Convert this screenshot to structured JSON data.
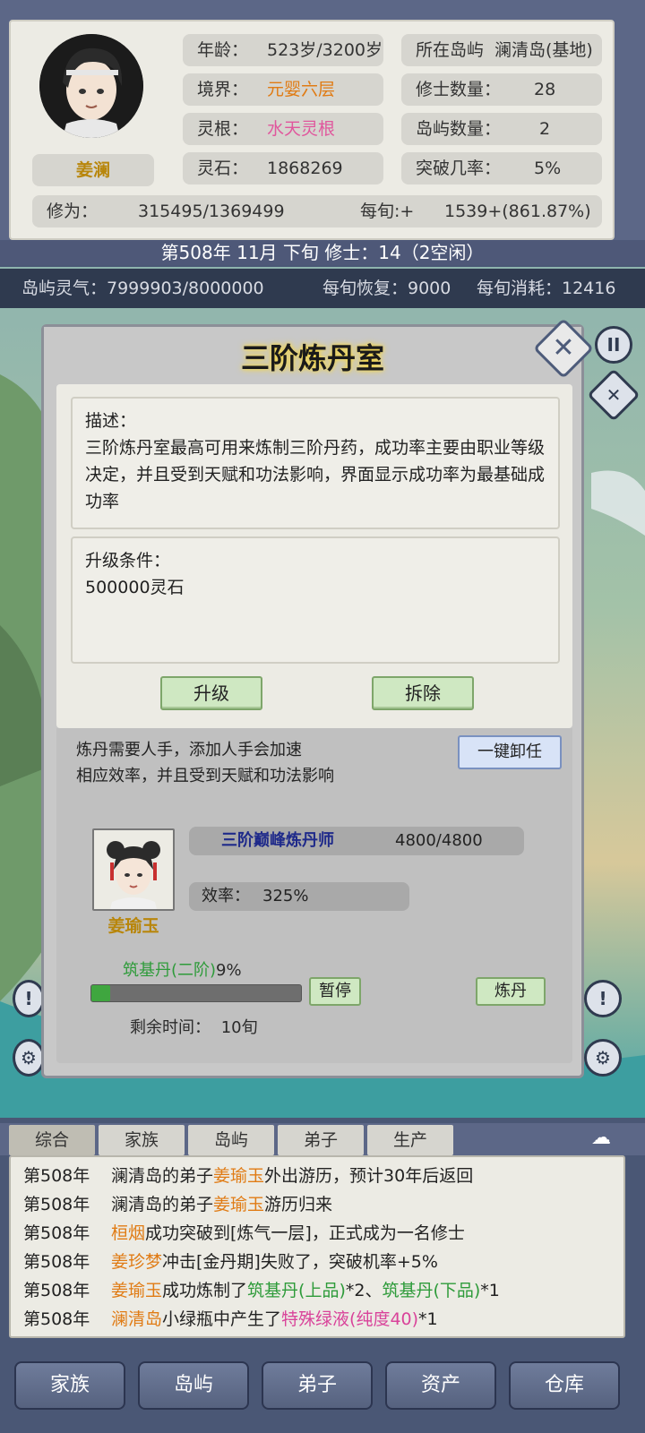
{
  "character": {
    "name": "姜澜",
    "age_label": "年龄：",
    "age_value": "523岁/3200岁",
    "realm_label": "境界：",
    "realm_value": "元婴六层",
    "root_label": "灵根：",
    "root_value": "水天灵根",
    "stone_label": "灵石：",
    "stone_value": "1868269",
    "island_label": "所在岛屿",
    "island_value": "澜清岛(基地)",
    "cultivators_label": "修士数量：",
    "cultivators_value": "28",
    "islands_label": "岛屿数量：",
    "islands_value": "2",
    "breakthrough_label": "突破几率：",
    "breakthrough_value": "5%",
    "cultivation_label": "修为：",
    "cultivation_value": "315495/1369499",
    "per_period_label": "每旬:+",
    "per_period_value": "1539+(861.87%)"
  },
  "date_bar": "第508年 11月 下旬   修士：14（2空闲）",
  "qi_bar": {
    "island_qi": "岛屿灵气：7999903/8000000",
    "recovery": "每旬恢复：9000",
    "consumption": "每旬消耗：12416"
  },
  "dialog": {
    "title": "三阶炼丹室",
    "desc_label": "描述：",
    "desc_text": "三阶炼丹室最高可用来炼制三阶丹药，成功率主要由职业等级决定，并且受到天赋和功法影响，界面显示成功率为最基础成功率",
    "upgrade_label": "升级条件：",
    "upgrade_cost": "500000灵石",
    "upgrade_button": "升级",
    "demolish_button": "拆除",
    "work_note_line1": "炼丹需要人手，添加人手会加速",
    "work_note_line2": "相应效率，并且受到天赋和功法影响",
    "unassign_button": "一键卸任",
    "worker_title": "三阶巅峰炼丹师",
    "worker_exp": "4800/4800",
    "efficiency_label": "效率：",
    "efficiency_value": "325%",
    "worker_name": "姜瑜玉",
    "craft_item": "筑基丹(二阶)",
    "craft_percent": "9%",
    "craft_progress": 0.09,
    "pause_button": "暂停",
    "craft_button": "炼丹",
    "remaining_label": "剩余时间：",
    "remaining_value": "10旬"
  },
  "log_tabs": [
    "综合",
    "家族",
    "岛屿",
    "弟子",
    "生产"
  ],
  "logs": [
    {
      "year": "第508年",
      "parts": [
        [
          "澜清岛的弟子",
          ""
        ],
        [
          "姜瑜玉",
          "orange"
        ],
        [
          "外出游历，预计30年后返回",
          ""
        ]
      ]
    },
    {
      "year": "第508年",
      "parts": [
        [
          "澜清岛的弟子",
          ""
        ],
        [
          "姜瑜玉",
          "orange"
        ],
        [
          "游历归来",
          ""
        ]
      ]
    },
    {
      "year": "第508年",
      "parts": [
        [
          "桓烟",
          "orange"
        ],
        [
          "成功突破到[炼气一层]，正式成为一名修士",
          ""
        ]
      ]
    },
    {
      "year": "第508年",
      "parts": [
        [
          "姜珍梦",
          "orange"
        ],
        [
          "冲击[金丹期]失败了，突破机率+5%",
          ""
        ]
      ]
    },
    {
      "year": "第508年",
      "parts": [
        [
          "姜瑜玉",
          "orange"
        ],
        [
          "成功炼制了",
          ""
        ],
        [
          "筑基丹(上品)",
          "green"
        ],
        [
          "*2、",
          ""
        ],
        [
          "筑基丹(下品)",
          "green"
        ],
        [
          "*1",
          ""
        ]
      ]
    },
    {
      "year": "第508年",
      "parts": [
        [
          "澜清岛",
          "orange"
        ],
        [
          "小绿瓶中产生了",
          ""
        ],
        [
          "特殊绿液(纯度40)",
          "pink"
        ],
        [
          "*1",
          ""
        ]
      ]
    }
  ],
  "nav": [
    "家族",
    "岛屿",
    "弟子",
    "资产",
    "仓库"
  ],
  "colors": {
    "orange": "#e07b14",
    "green": "#2e9b3a",
    "pink": "#d9439a"
  }
}
